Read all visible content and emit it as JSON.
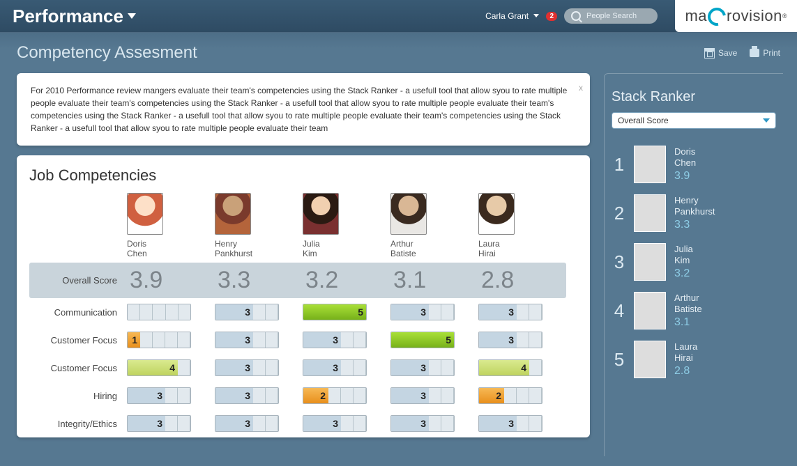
{
  "header": {
    "app_title": "Performance",
    "user_name": "Carla Grant",
    "notification_count": "2",
    "search_placeholder": "People Search",
    "brand_prefix": "ma",
    "brand_suffix": "rovision"
  },
  "page": {
    "title": "Competency Assesment",
    "save_label": "Save",
    "print_label": "Print",
    "info_text": "For 2010 Performance review mangers evaluate their team's competencies using the Stack Ranker - a usefull tool that allow syou to rate multiple people evaluate their team's competencies using the Stack Ranker - a usefull tool that allow syou to rate multiple people evaluate their team's competencies using the Stack Ranker - a usefull tool that allow syou to rate multiple people evaluate their team's competencies using the Stack Ranker - a usefull tool that allow syou to rate multiple people evaluate their team"
  },
  "competencies": {
    "title": "Job Competencies",
    "people": [
      {
        "first": "Doris",
        "last": "Chen",
        "avatar": "av1"
      },
      {
        "first": "Henry",
        "last": "Pankhurst",
        "avatar": "av2"
      },
      {
        "first": "Julia",
        "last": "Kim",
        "avatar": "av3"
      },
      {
        "first": "Arthur",
        "last": "Batiste",
        "avatar": "av4"
      },
      {
        "first": "Laura",
        "last": "Hirai",
        "avatar": "av5"
      }
    ],
    "overall_label": "Overall Score",
    "overall": [
      "3.9",
      "3.3",
      "3.2",
      "3.1",
      "2.8"
    ],
    "rows": [
      {
        "label": "Communication",
        "scores": [
          {
            "v": 0,
            "c": "none"
          },
          {
            "v": 3,
            "c": "blue"
          },
          {
            "v": 5,
            "c": "green"
          },
          {
            "v": 3,
            "c": "blue"
          },
          {
            "v": 3,
            "c": "blue"
          }
        ]
      },
      {
        "label": "Customer Focus",
        "scores": [
          {
            "v": 1,
            "c": "orange"
          },
          {
            "v": 3,
            "c": "blue"
          },
          {
            "v": 3,
            "c": "blue"
          },
          {
            "v": 5,
            "c": "green"
          },
          {
            "v": 3,
            "c": "blue"
          }
        ]
      },
      {
        "label": "Customer Focus",
        "scores": [
          {
            "v": 4,
            "c": "lime"
          },
          {
            "v": 3,
            "c": "blue"
          },
          {
            "v": 3,
            "c": "blue"
          },
          {
            "v": 3,
            "c": "blue"
          },
          {
            "v": 4,
            "c": "lime"
          }
        ]
      },
      {
        "label": "Hiring",
        "scores": [
          {
            "v": 3,
            "c": "blue"
          },
          {
            "v": 3,
            "c": "blue"
          },
          {
            "v": 2,
            "c": "orange"
          },
          {
            "v": 3,
            "c": "blue"
          },
          {
            "v": 2,
            "c": "orange"
          }
        ]
      },
      {
        "label": "Integrity/Ethics",
        "scores": [
          {
            "v": 3,
            "c": "blue"
          },
          {
            "v": 3,
            "c": "blue"
          },
          {
            "v": 3,
            "c": "blue"
          },
          {
            "v": 3,
            "c": "blue"
          },
          {
            "v": 3,
            "c": "blue"
          }
        ]
      }
    ]
  },
  "ranker": {
    "title": "Stack Ranker",
    "dropdown": "Overall Score",
    "list": [
      {
        "rank": "1",
        "first": "Doris",
        "last": "Chen",
        "score": "3.9",
        "avatar": "av1"
      },
      {
        "rank": "2",
        "first": "Henry",
        "last": "Pankhurst",
        "score": "3.3",
        "avatar": "av2"
      },
      {
        "rank": "3",
        "first": "Julia",
        "last": "Kim",
        "score": "3.2",
        "avatar": "av3"
      },
      {
        "rank": "4",
        "first": "Arthur",
        "last": "Batiste",
        "score": "3.1",
        "avatar": "av4"
      },
      {
        "rank": "5",
        "first": "Laura",
        "last": "Hirai",
        "score": "2.8",
        "avatar": "av5"
      }
    ]
  },
  "chart_data": {
    "type": "table",
    "title": "Job Competencies",
    "columns": [
      "Doris Chen",
      "Henry Pankhurst",
      "Julia Kim",
      "Arthur Batiste",
      "Laura Hirai"
    ],
    "overall_score": [
      3.9,
      3.3,
      3.2,
      3.1,
      2.8
    ],
    "rows": [
      {
        "metric": "Communication",
        "values": [
          null,
          3,
          5,
          3,
          3
        ]
      },
      {
        "metric": "Customer Focus",
        "values": [
          1,
          3,
          3,
          5,
          3
        ]
      },
      {
        "metric": "Customer Focus",
        "values": [
          4,
          3,
          3,
          3,
          4
        ]
      },
      {
        "metric": "Hiring",
        "values": [
          3,
          3,
          2,
          3,
          2
        ]
      },
      {
        "metric": "Integrity/Ethics",
        "values": [
          3,
          3,
          3,
          3,
          3
        ]
      }
    ],
    "scale": {
      "min": 1,
      "max": 5
    }
  }
}
